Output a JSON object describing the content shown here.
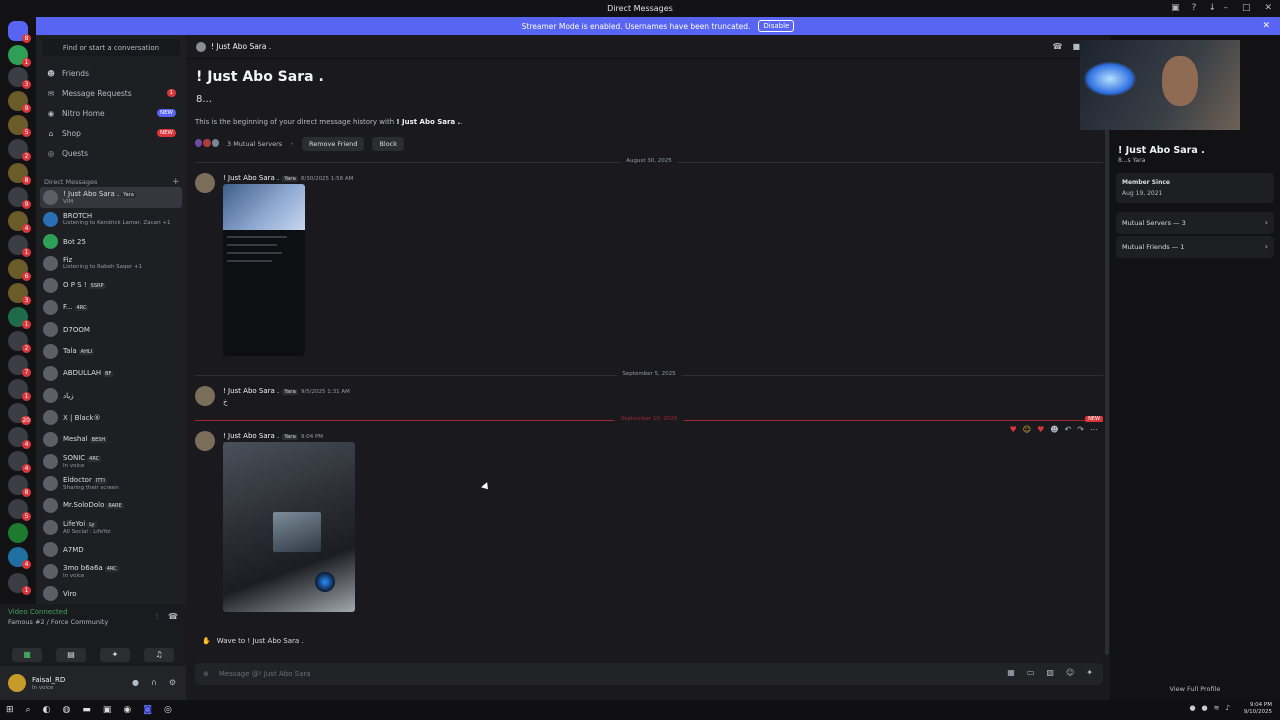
{
  "window": {
    "title": "Direct Messages"
  },
  "streamer": {
    "text": "Streamer Mode is enabled. Usernames have been truncated.",
    "disable_label": "Disable"
  },
  "sidebar": {
    "find_placeholder": "Find or start a conversation",
    "nav": [
      {
        "label": "Friends",
        "icon": "friends-icon"
      },
      {
        "label": "Message Requests",
        "icon": "message-requests-icon",
        "badge": "1"
      },
      {
        "label": "Nitro Home",
        "icon": "nitro-icon",
        "badge": "NEW"
      },
      {
        "label": "Shop",
        "icon": "shop-icon",
        "badge": "NEW"
      },
      {
        "label": "Quests",
        "icon": "quests-icon"
      }
    ],
    "dm_header": "Direct Messages",
    "dms": [
      {
        "name": "! Just Abo Sara .",
        "tag": "Yara",
        "sub": "VIM"
      },
      {
        "name": "BROTCH",
        "sub": "Listening to Kendrick Lamar, Zacari +1"
      },
      {
        "name": "Bot 25",
        "sub": ""
      },
      {
        "name": "Fiz",
        "sub": "Listening to Rabeh Saqer +1"
      },
      {
        "name": "O P S !",
        "tag": "SSRP",
        "sub": ""
      },
      {
        "name": "F...",
        "tag": "4RC",
        "sub": ""
      },
      {
        "name": "D7OOM",
        "sub": ""
      },
      {
        "name": "Tala",
        "tag": "AHLI",
        "sub": ""
      },
      {
        "name": "ABDULLAH",
        "tag": "BF",
        "sub": ""
      },
      {
        "name": "زياد",
        "sub": ""
      },
      {
        "name": "X | Black®",
        "sub": ""
      },
      {
        "name": "Meshal",
        "tag": "BESH",
        "sub": ""
      },
      {
        "name": "SONIC",
        "tag": "4RC",
        "sub": "In voice"
      },
      {
        "name": "Eldoctor",
        "tag": "ITTI",
        "sub": "Sharing their screen"
      },
      {
        "name": "Mr.SoloDolo",
        "tag": "RARE",
        "sub": ""
      },
      {
        "name": "LifeYoi",
        "tag": "Ly",
        "sub": "All Social : LifeYoi"
      },
      {
        "name": "A7MD",
        "sub": ""
      },
      {
        "name": "3mo b6a6a",
        "tag": "4RC",
        "sub": "In voice"
      },
      {
        "name": "Viro",
        "sub": ""
      }
    ]
  },
  "voice": {
    "status": "Video Connected",
    "channel": "Famous #2 / Force Community"
  },
  "user": {
    "name": "Faisal_RD",
    "status": "In voice"
  },
  "chat": {
    "header_name": "! Just Abo Sara .",
    "intro_name": "! Just Abo Sara .",
    "intro_username": "8...",
    "intro_desc_prefix": "This is the beginning of your direct message history with ",
    "intro_desc_name": "! Just Abo Sara .",
    "intro_desc_suffix": ".",
    "mutual_servers": "3 Mutual Servers",
    "remove_friend": "Remove Friend",
    "block": "Block",
    "dividers": [
      "August 30, 2025",
      "September 5, 2025",
      "September 10, 2025"
    ],
    "new_label": "NEW",
    "messages": [
      {
        "author": "! Just Abo Sara .",
        "tag": "Yara",
        "time": "8/30/2025 1:58 AM",
        "body": ""
      },
      {
        "author": "! Just Abo Sara .",
        "tag": "Yara",
        "time": "9/5/2025 1:31 AM",
        "body": "خ"
      },
      {
        "author": "! Just Abo Sara .",
        "tag": "Yara",
        "time": "9:04 PM",
        "body": ""
      }
    ],
    "wave_text": "Wave to ! Just Abo Sara .",
    "composer_placeholder": "Message @! Just Abo Sara"
  },
  "profile": {
    "name": "! Just Abo Sara .",
    "sub": "8...s",
    "sub_tag": "Yara",
    "member_since_label": "Member Since",
    "member_since": "Aug 19, 2021",
    "mutual_servers": "Mutual Servers — 3",
    "mutual_friends": "Mutual Friends — 1",
    "view_full": "View Full Profile"
  },
  "taskbar": {
    "time": "9:04 PM",
    "date": "9/10/2025"
  },
  "colors": {
    "accent": "#5865f2",
    "danger": "#da373c",
    "online": "#43a25a"
  }
}
